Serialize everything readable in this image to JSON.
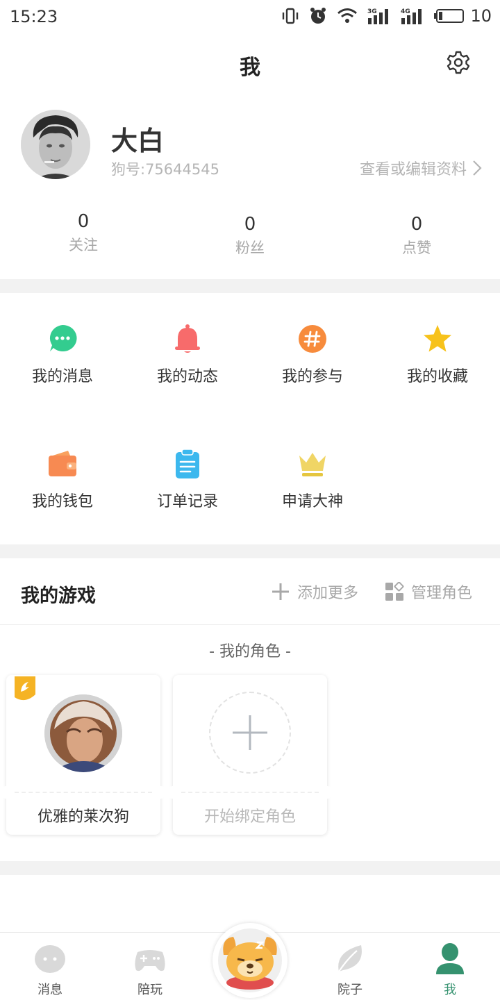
{
  "status_bar": {
    "time": "15:23",
    "battery": "10",
    "network_left": "3G",
    "network_right": "4G"
  },
  "header": {
    "title": "我"
  },
  "profile": {
    "nickname": "大白",
    "user_id": "狗号:75644545",
    "edit_link": "查看或编辑资料",
    "stats": [
      {
        "count": "0",
        "label": "关注"
      },
      {
        "count": "0",
        "label": "粉丝"
      },
      {
        "count": "0",
        "label": "点赞"
      }
    ]
  },
  "quick_grid": {
    "items": [
      {
        "label": "我的消息",
        "icon": "chat-bubble-icon",
        "color": "#33cc8f"
      },
      {
        "label": "我的动态",
        "icon": "bell-icon",
        "color": "#f76b6b"
      },
      {
        "label": "我的参与",
        "icon": "hashtag-icon",
        "color": "#f78b3c"
      },
      {
        "label": "我的收藏",
        "icon": "star-icon",
        "color": "#f7c21b"
      },
      {
        "label": "我的钱包",
        "icon": "wallet-icon",
        "color": "#f78a52"
      },
      {
        "label": "订单记录",
        "icon": "clipboard-icon",
        "color": "#3cb8ee"
      },
      {
        "label": "申请大神",
        "icon": "crown-icon",
        "color": "#e5c640"
      }
    ]
  },
  "my_games": {
    "title": "我的游戏",
    "add_more": "添加更多",
    "manage_roles": "管理角色",
    "roles_caption": "-  我的角色  -",
    "roles": [
      {
        "name": "优雅的莱次狗"
      },
      {
        "name": "开始绑定角色"
      }
    ]
  },
  "tab_bar": {
    "tabs": [
      {
        "label": "消息",
        "icon": "chat-face-icon"
      },
      {
        "label": "陪玩",
        "icon": "gamepad-icon"
      },
      {
        "label": "",
        "icon": "dog-mascot-icon"
      },
      {
        "label": "院子",
        "icon": "leaf-icon"
      },
      {
        "label": "我",
        "icon": "person-icon",
        "active": true
      }
    ],
    "active_color": "#35926f"
  }
}
